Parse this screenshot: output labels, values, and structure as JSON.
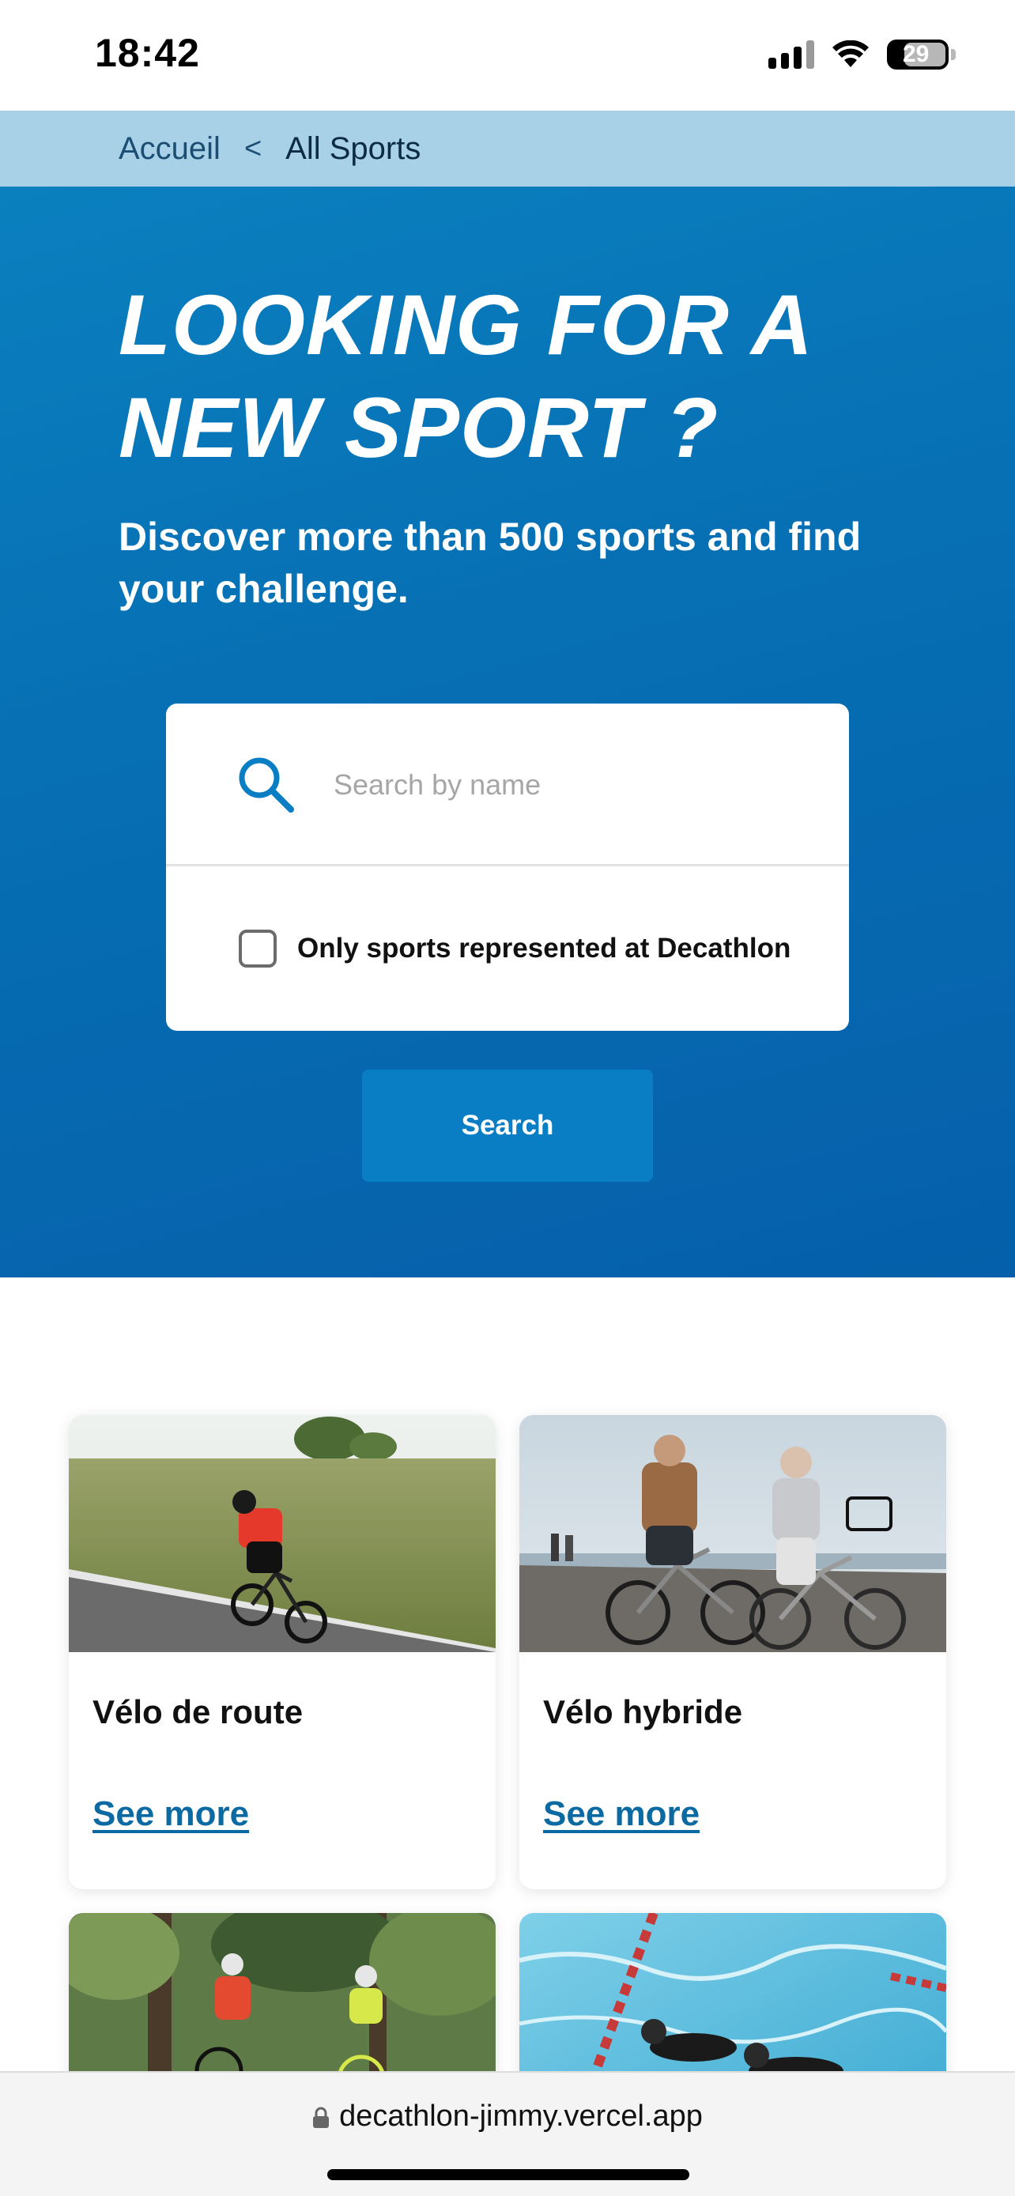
{
  "status_bar": {
    "time": "18:42",
    "battery": "29"
  },
  "breadcrumb": {
    "home": "Accueil",
    "separator": "<",
    "current": "All Sports"
  },
  "hero": {
    "title": "LOOKING FOR A NEW SPORT ?",
    "subtitle": "Discover more than 500 sports and find your challenge."
  },
  "search": {
    "placeholder": "Search by name",
    "checkbox_label": "Only sports represented at Decathlon",
    "checkbox_checked": false,
    "button_label": "Search"
  },
  "cards": [
    {
      "title": "Vélo de route",
      "link": "See more"
    },
    {
      "title": "Vélo hybride",
      "link": "See more"
    },
    {
      "title": "",
      "link": ""
    },
    {
      "title": "",
      "link": ""
    }
  ],
  "browser": {
    "url": "decathlon-jimmy.vercel.app"
  },
  "colors": {
    "breadcrumb_bg": "#a8d1e8",
    "hero_bg": "#0770b4",
    "accent": "#0a7ec4",
    "link": "#0b6aa2"
  }
}
